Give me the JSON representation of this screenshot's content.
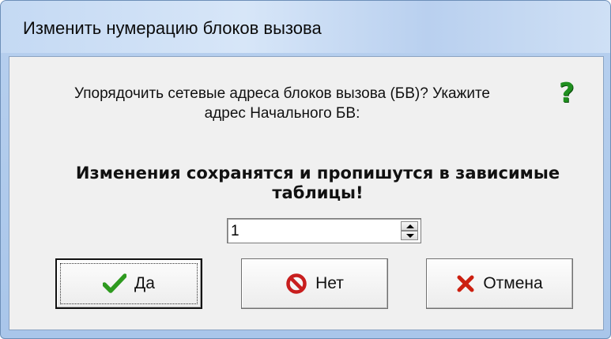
{
  "window": {
    "title": "Изменить нумерацию блоков вызова"
  },
  "dialog": {
    "question_line1": "Упорядочить сетевые адреса блоков вызова (БВ)? Укажите",
    "question_line2": "адрес Начального БВ:",
    "question_icon": "question-mark-icon",
    "question_mark_text": "?",
    "warning_line1": "Изменения сохранятся и пропишутся в зависимые",
    "warning_line2": "таблицы!",
    "start_address": {
      "value": "1"
    }
  },
  "buttons": {
    "yes": {
      "label": "Да",
      "icon": "checkmark-icon"
    },
    "no": {
      "label": "Нет",
      "icon": "no-entry-icon"
    },
    "cancel": {
      "label": "Отмена",
      "icon": "cross-icon"
    }
  },
  "colors": {
    "question_green": "#1f8f1f",
    "check_green": "#2e9a1f",
    "no_red": "#c81e1e",
    "cancel_red": "#cc2010"
  }
}
